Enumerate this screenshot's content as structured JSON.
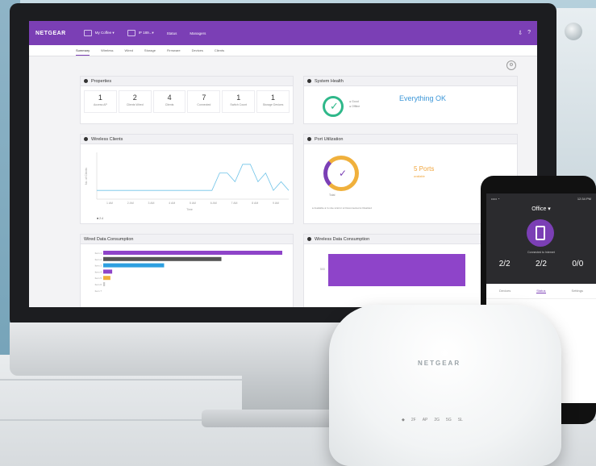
{
  "app": {
    "logo": "NETGEAR",
    "topbar_items": [
      "My Coffee ▾",
      "IP 189...▾",
      "Status",
      "Managers"
    ],
    "topbar_right": [
      "⇩",
      "?"
    ]
  },
  "nav_tabs": [
    "Summary",
    "Wireless",
    "Wired",
    "Storage",
    "Firmware",
    "Devices",
    "Clients"
  ],
  "nav_active": 0,
  "cards": {
    "properties": {
      "title": "Properties",
      "items": [
        {
          "num": "1",
          "label": "Access AP"
        },
        {
          "num": "2",
          "label": "Clients Wired"
        },
        {
          "num": "4",
          "label": "Clients"
        },
        {
          "num": "7",
          "label": "Connected"
        },
        {
          "num": "1",
          "label": "Switch Count"
        },
        {
          "num": "1",
          "label": "Storage Devices"
        }
      ]
    },
    "health": {
      "title": "System Health",
      "legend": [
        "● Good",
        "● Offline"
      ],
      "status": "Everything OK"
    },
    "wireless_clients": {
      "title": "Wireless Clients",
      "ylabel": "No. of Clients",
      "xlabel": "Time",
      "ticks": [
        "1 AM",
        "2 AM",
        "3 AM",
        "4 AM",
        "5 AM",
        "6 AM",
        "7 AM",
        "8 AM",
        "9 AM"
      ],
      "legend": "■ 2.4"
    },
    "port_utilization": {
      "title": "Port Utilization",
      "ring_label": "Total",
      "value": "5 Ports",
      "value_sub": "available",
      "legend": "● Available  ● In-Use  ● Error  ● Disconnected  ● Disabled"
    },
    "wired_data": {
      "title": "Wired Data Consumption"
    },
    "wireless_data": {
      "title": "Wireless Data Consumption"
    }
  },
  "wired_bars": {
    "categories": [
      "Item 1",
      "Item 2",
      "Item 3",
      "Item 4",
      "Item 5",
      "Item 6",
      "Item 7"
    ],
    "values": [
      100,
      66,
      34,
      5,
      4,
      1,
      0
    ],
    "colors": [
      "#8e44c9",
      "#555555",
      "#2d9fe0",
      "#8e44c9",
      "#f0b03c",
      "#cccccc",
      "#cccccc"
    ]
  },
  "wireless_bar": {
    "value": 100,
    "tick": "500"
  },
  "line_series": {
    "values": [
      1,
      1,
      1,
      1,
      1,
      1,
      1,
      1,
      1,
      1,
      1,
      1,
      1,
      1,
      1,
      1,
      3,
      3,
      2,
      4,
      4,
      2,
      3,
      1,
      2,
      1
    ]
  },
  "phone": {
    "status_left": "••••• ◔",
    "status_right": "12:34 PM",
    "title": "Office ▾",
    "caption": "Connected to Internet",
    "stats": [
      "2/2",
      "2/2",
      "0/0"
    ],
    "tabs": [
      "Devices",
      "Status",
      "Settings"
    ],
    "active_tab": 1
  },
  "device": {
    "logo": "NETGEAR",
    "leds": [
      "◆",
      "2F",
      "AP",
      "2G",
      "5G",
      "SL"
    ]
  },
  "settings_icon": "gear-icon"
}
